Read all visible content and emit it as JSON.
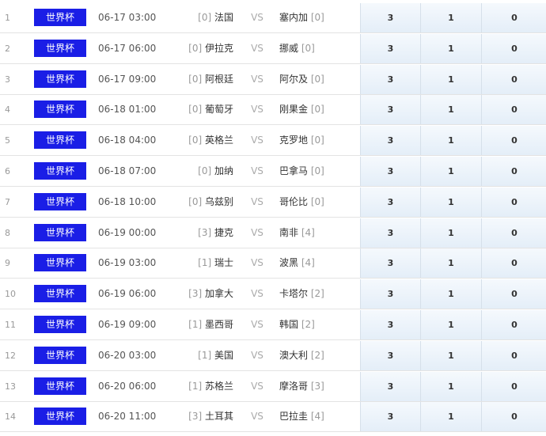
{
  "league_label": "世界杯",
  "vs_label": "VS",
  "matches": [
    {
      "index": "1",
      "time": "06-17 03:00",
      "home_rank": "[0]",
      "home": "法国",
      "away": "塞内加",
      "away_rank": "[0]",
      "odds": [
        "3",
        "1",
        "0"
      ]
    },
    {
      "index": "2",
      "time": "06-17 06:00",
      "home_rank": "[0]",
      "home": "伊拉克",
      "away": "挪威",
      "away_rank": "[0]",
      "odds": [
        "3",
        "1",
        "0"
      ]
    },
    {
      "index": "3",
      "time": "06-17 09:00",
      "home_rank": "[0]",
      "home": "阿根廷",
      "away": "阿尔及",
      "away_rank": "[0]",
      "odds": [
        "3",
        "1",
        "0"
      ]
    },
    {
      "index": "4",
      "time": "06-18 01:00",
      "home_rank": "[0]",
      "home": "葡萄牙",
      "away": "刚果金",
      "away_rank": "[0]",
      "odds": [
        "3",
        "1",
        "0"
      ]
    },
    {
      "index": "5",
      "time": "06-18 04:00",
      "home_rank": "[0]",
      "home": "英格兰",
      "away": "克罗地",
      "away_rank": "[0]",
      "odds": [
        "3",
        "1",
        "0"
      ]
    },
    {
      "index": "6",
      "time": "06-18 07:00",
      "home_rank": "[0]",
      "home": "加纳",
      "away": "巴拿马",
      "away_rank": "[0]",
      "odds": [
        "3",
        "1",
        "0"
      ]
    },
    {
      "index": "7",
      "time": "06-18 10:00",
      "home_rank": "[0]",
      "home": "乌兹别",
      "away": "哥伦比",
      "away_rank": "[0]",
      "odds": [
        "3",
        "1",
        "0"
      ]
    },
    {
      "index": "8",
      "time": "06-19 00:00",
      "home_rank": "[3]",
      "home": "捷克",
      "away": "南非",
      "away_rank": "[4]",
      "odds": [
        "3",
        "1",
        "0"
      ]
    },
    {
      "index": "9",
      "time": "06-19 03:00",
      "home_rank": "[1]",
      "home": "瑞士",
      "away": "波黑",
      "away_rank": "[4]",
      "odds": [
        "3",
        "1",
        "0"
      ]
    },
    {
      "index": "10",
      "time": "06-19 06:00",
      "home_rank": "[3]",
      "home": "加拿大",
      "away": "卡塔尔",
      "away_rank": "[2]",
      "odds": [
        "3",
        "1",
        "0"
      ]
    },
    {
      "index": "11",
      "time": "06-19 09:00",
      "home_rank": "[1]",
      "home": "墨西哥",
      "away": "韩国",
      "away_rank": "[2]",
      "odds": [
        "3",
        "1",
        "0"
      ]
    },
    {
      "index": "12",
      "time": "06-20 03:00",
      "home_rank": "[1]",
      "home": "美国",
      "away": "澳大利",
      "away_rank": "[2]",
      "odds": [
        "3",
        "1",
        "0"
      ]
    },
    {
      "index": "13",
      "time": "06-20 06:00",
      "home_rank": "[1]",
      "home": "苏格兰",
      "away": "摩洛哥",
      "away_rank": "[3]",
      "odds": [
        "3",
        "1",
        "0"
      ]
    },
    {
      "index": "14",
      "time": "06-20 11:00",
      "home_rank": "[3]",
      "home": "土耳其",
      "away": "巴拉圭",
      "away_rank": "[4]",
      "odds": [
        "3",
        "1",
        "0"
      ]
    }
  ]
}
